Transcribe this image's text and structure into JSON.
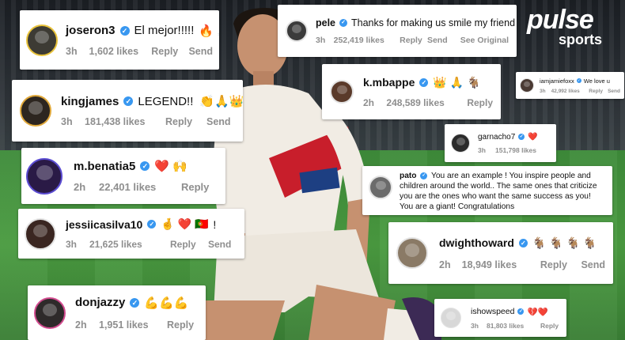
{
  "brand": {
    "name": "pulse",
    "section": "sports"
  },
  "comments": [
    {
      "user": "joseron3",
      "text": "El mejor!!!!!",
      "emoji": "🔥 👏",
      "time": "3h",
      "likes": "1,602 likes",
      "actions": [
        "Reply",
        "Send"
      ]
    },
    {
      "user": "pele",
      "text": "Thanks for making us smile my friend",
      "emoji": "🙏",
      "time": "3h",
      "likes": "252,419 likes",
      "actions": [
        "Reply",
        "Send",
        "See Original"
      ]
    },
    {
      "user": "kingjames",
      "text": "LEGEND!!",
      "emoji": "👏🙏👑",
      "time": "3h",
      "likes": "181,438 likes",
      "actions": [
        "Reply",
        "Send"
      ]
    },
    {
      "user": "k.mbappe",
      "text": "",
      "emoji": "👑 🙏 🐐",
      "time": "2h",
      "likes": "248,589 likes",
      "actions": [
        "Reply"
      ]
    },
    {
      "user": "iamjamiefoxx",
      "text": "We love u",
      "emoji": "",
      "time": "3h",
      "likes": "42,992 likes",
      "actions": [
        "Reply",
        "Send"
      ]
    },
    {
      "user": "garnacho7",
      "text": "",
      "emoji": "❤️",
      "time": "3h",
      "likes": "151,798 likes",
      "actions": []
    },
    {
      "user": "m.benatia5",
      "text": "",
      "emoji": "❤️ 🙌",
      "time": "2h",
      "likes": "22,401 likes",
      "actions": [
        "Reply"
      ]
    },
    {
      "user": "pato",
      "text": "You are an example ! You inspire people and children around the world.. The same ones that criticize you are the ones who want the same success as you! You are a giant! Congratulations",
      "emoji": "",
      "time": "",
      "likes": "",
      "actions": []
    },
    {
      "user": "jessiicasilva10",
      "text": "!",
      "emoji": "🤞 ❤️ 🇵🇹",
      "time": "3h",
      "likes": "21,625 likes",
      "actions": [
        "Reply",
        "Send"
      ]
    },
    {
      "user": "dwighthoward",
      "text": "",
      "emoji": "🐐 🐐 🐐 🐐",
      "time": "2h",
      "likes": "18,949 likes",
      "actions": [
        "Reply",
        "Send"
      ]
    },
    {
      "user": "donjazzy",
      "text": "",
      "emoji": "💪💪💪",
      "time": "2h",
      "likes": "1,951 likes",
      "actions": [
        "Reply"
      ]
    },
    {
      "user": "ishowspeed",
      "text": "",
      "emoji": "💔❤️",
      "time": "3h",
      "likes": "81,803 likes",
      "actions": [
        "Reply"
      ]
    }
  ],
  "colors": {
    "verified": "#3897f0",
    "meta_text": "#8e8e8e",
    "card_bg": "#ffffff",
    "shirt": "#f1ece4",
    "shirt_accent": "#c81e2b"
  }
}
